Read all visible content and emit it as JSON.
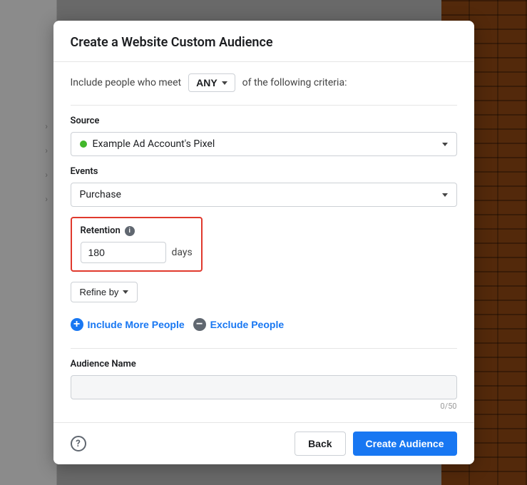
{
  "modal": {
    "title": "Create a Website Custom Audience",
    "include_criteria_prefix": "Include people who meet",
    "include_criteria_suffix": "of the following criteria:",
    "any_label": "ANY",
    "source": {
      "label": "Source",
      "value": "Example Ad Account's Pixel"
    },
    "events": {
      "label": "Events",
      "value": "Purchase"
    },
    "retention": {
      "label": "Retention",
      "value": "180",
      "unit": "days"
    },
    "refine_by": "Refine by",
    "include_more_people": "Include More People",
    "exclude_people": "Exclude People",
    "audience_name": {
      "label": "Audience Name",
      "placeholder": "",
      "char_count": "0/50"
    }
  },
  "footer": {
    "back_label": "Back",
    "create_label": "Create Audience"
  }
}
